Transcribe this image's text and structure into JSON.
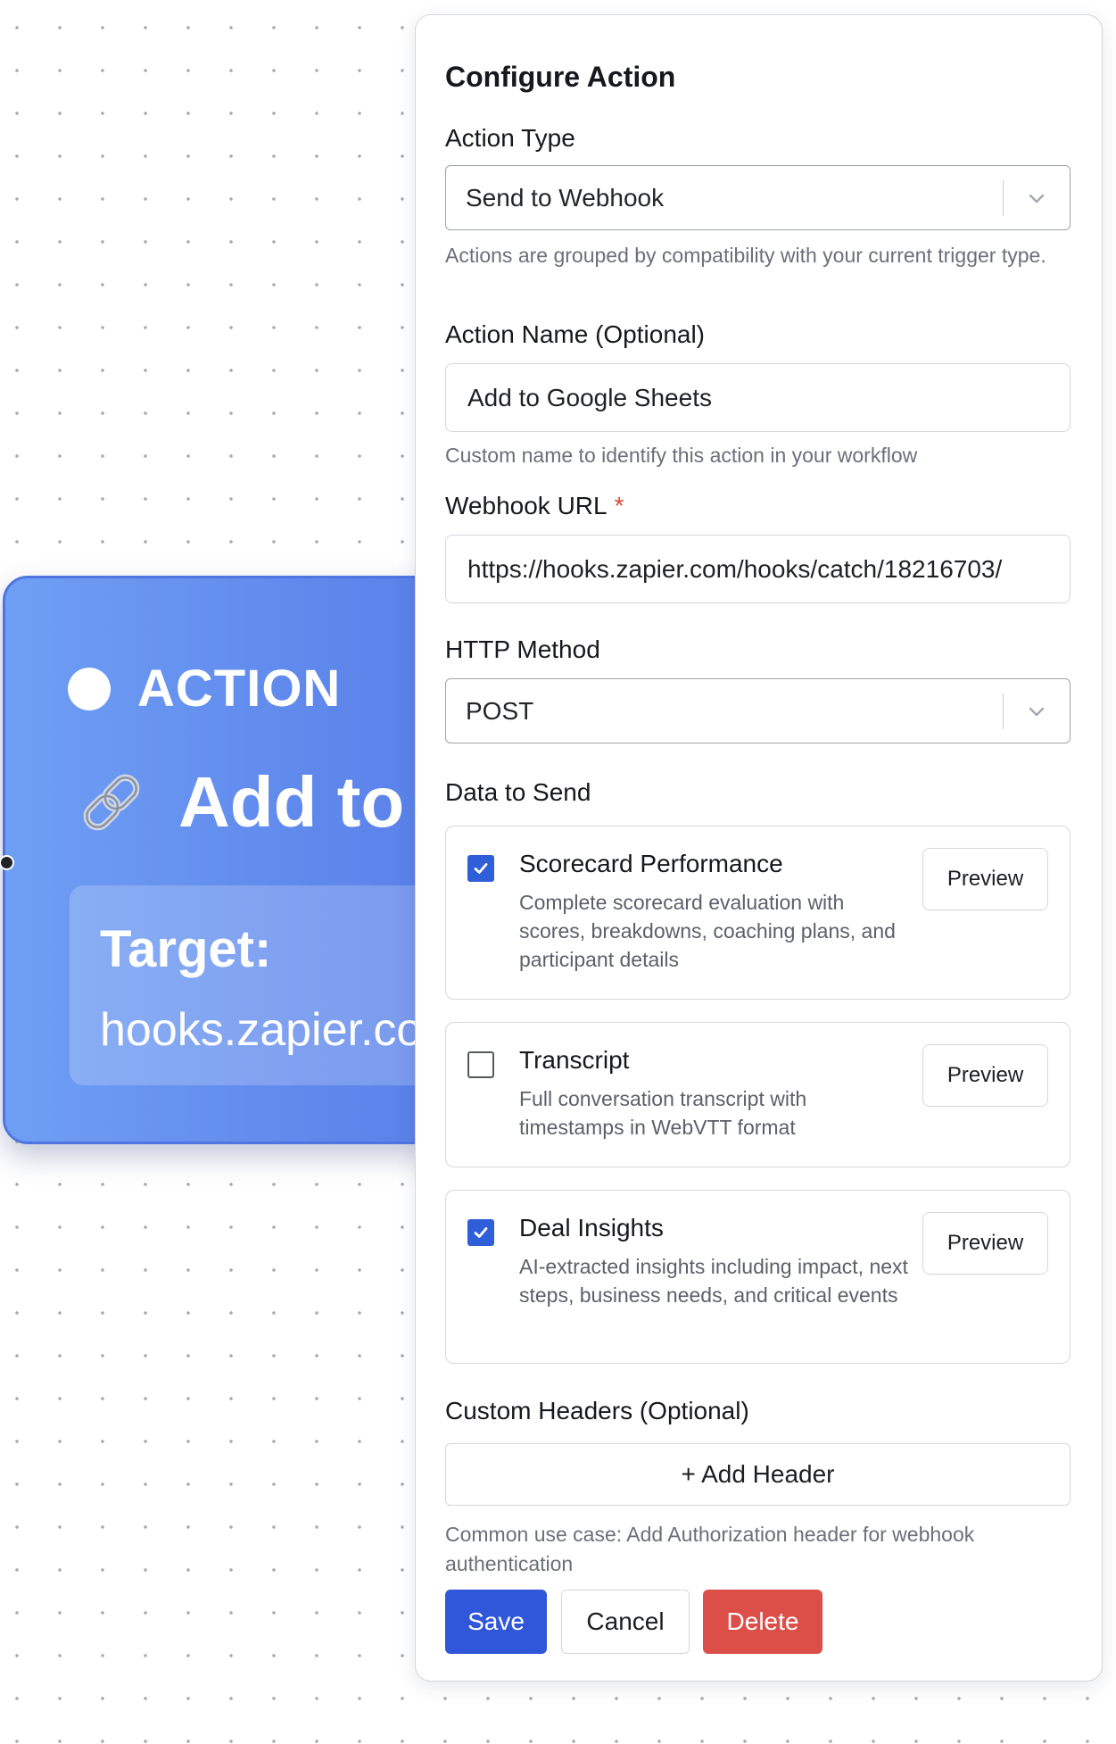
{
  "node": {
    "type_label": "ACTION",
    "title": "Add to Google Sheets",
    "target_label": "Target:",
    "target_value": "hooks.zapier.com"
  },
  "panel": {
    "title": "Configure Action",
    "action_type": {
      "label": "Action Type",
      "value": "Send to Webhook",
      "help": "Actions are grouped by compatibility with your current trigger type."
    },
    "action_name": {
      "label": "Action Name (Optional)",
      "value": "Add to Google Sheets",
      "help": "Custom name to identify this action in your workflow"
    },
    "webhook_url": {
      "label": "Webhook URL",
      "required_mark": "*",
      "value": "https://hooks.zapier.com/hooks/catch/18216703/"
    },
    "http_method": {
      "label": "HTTP Method",
      "value": "POST"
    },
    "data_to_send": {
      "label": "Data to Send",
      "items": [
        {
          "title": "Scorecard Performance",
          "description": "Complete scorecard evaluation with scores, breakdowns, coaching plans, and participant details",
          "checked": true,
          "preview_label": "Preview"
        },
        {
          "title": "Transcript",
          "description": "Full conversation transcript with timestamps in WebVTT format",
          "checked": false,
          "preview_label": "Preview"
        },
        {
          "title": "Deal Insights",
          "description": "AI-extracted insights including impact, next steps, business needs, and critical events",
          "checked": true,
          "preview_label": "Preview"
        }
      ]
    },
    "custom_headers": {
      "label": "Custom Headers (Optional)",
      "add_button": "+ Add Header",
      "help": "Common use case: Add Authorization header for webhook authentication"
    },
    "buttons": {
      "save": "Save",
      "cancel": "Cancel",
      "delete": "Delete"
    }
  },
  "colors": {
    "node_gradient_start": "#6f9ff4",
    "node_gradient_end": "#5579e6",
    "primary": "#3057d9",
    "danger": "#dc4f49",
    "required": "#d9483b",
    "checkbox_checked": "#2f5fd8"
  },
  "icons": {
    "node_status": "status-dot-icon",
    "node_type": "link-icon",
    "select_arrow": "chevron-down-icon",
    "checkbox_mark": "check-icon"
  }
}
